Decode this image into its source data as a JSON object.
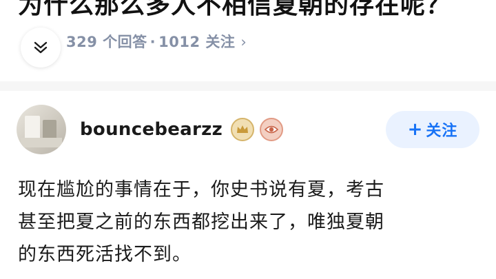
{
  "question": {
    "title": "为什么那么多人不相信夏朝的存在呢？",
    "answers_count": "329 个回答",
    "separator": "·",
    "followers_count": "1012 关注",
    "chevron": "›"
  },
  "answer": {
    "author": {
      "name": "bouncebearzz",
      "badges": [
        "crown-badge-icon",
        "eye-badge-icon"
      ]
    },
    "follow_button": {
      "plus": "+",
      "label": "关注"
    },
    "body_lines": [
      "现在尴尬的事情在于，你史书说有夏，考古",
      "甚至把夏之前的东西都挖出来了，唯独夏朝",
      "的东西死活找不到。"
    ]
  },
  "colors": {
    "meta_gray": "#8590a6",
    "follow_blue": "#1772f6",
    "follow_bg": "#eaf2ff",
    "divider": "#f6f6f6"
  }
}
